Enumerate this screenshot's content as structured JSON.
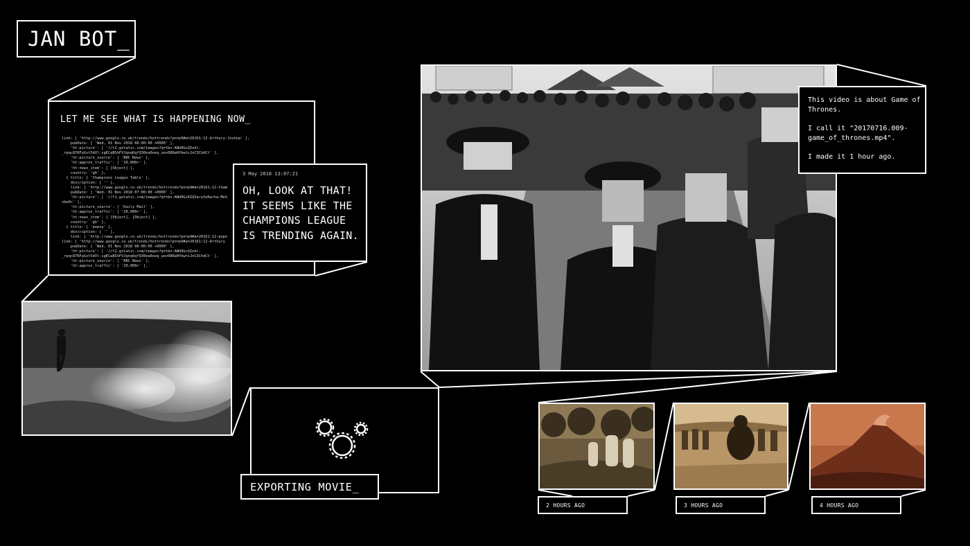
{
  "app": {
    "title": "JAN BOT_"
  },
  "log": {
    "heading": "LET ME SEE WHAT IS HAPPENING NOW_",
    "lines": [
      "link: [ 'http://www.google.co.uk/trends/hottrends?pn=p9#a=20161:12-Arthury-Joshua' ],",
      "    pubDate: [ 'Wed, 01 Nov 2018 08:00:00 +0000' ],",
      "    'ht:picture': [ '//t2.gstatic.com/images?q=tbn:ANd9GcQIekl-",
      "_rpqc87KFaSxt5dVl:sgECaBShFVJqnq6qfQ30ea0oeq_uev08RaHfbwtsJnC3ChdCt' ],",
      "    'ht:picture_source': [ 'BBC News' ],",
      "    'ht:approx_traffic': [ '20,000+' ],",
      "    'ht:news_item': [ [Object] ],",
      "    country: 'gb' },",
      "  { title: [ 'Champions League Table' ],",
      "    description: [ '' ],",
      "    link: [ 'http://www.google.co.uk/trends/hottrends?pn=p9#a=20161:12-Cham",
      "    pubDate: [ 'Wed, 01 Nov 2018 07:00:00 +0000' ],",
      "    'ht:picture': [ '//t1.gstatic.com/images?q=tbn:ANd9GcKIQVaryVoKarha:MoS",
      "vbeDc' ],",
      "    'ht:picture_source': [ 'Daily Mail' ],",
      "    'ht:approx_traffic': [ '20,000+' ],",
      "    'ht:news_item': [ [Object], [Object] ],",
      "    country: 'gb' },",
      "  { title: [ 'pepoy' ],",
      "    description: [ '' ],",
      "    link: [ 'http://www.google.co.uk/trends/hottrends?pn=p9#a=20161:12-pepo",
      "link: [ 'http://www.google.co.uk/trends/hottrends?pn=p9#a=20161:12-Arthury",
      "    pubDate: [ 'Wed, 01 Nov 2018 08:00:00 +0000' ],",
      "    'ht:picture': [ '//t2.gstatic.com/images?q=tbn:ANd9GcQIekl-",
      "_rpqc87KFaSxt5dVl:sgECaBShFVJqnq6qfQ30ea0oeq_uev08RaHfbwtsJnC3ChdCt' ],",
      "    'ht:picture_source': [ 'BBC News' ],",
      "    'ht:approx_traffic': [ '20,000+' ],"
    ]
  },
  "speech": {
    "date": "3 May 2018  13:07:21",
    "text": "OH, LOOK AT THAT! IT SEEMS LIKE THE CHAMPIONS LEAGUE IS TRENDING AGAIN."
  },
  "export": {
    "label": "EXPORTING MOVIE_"
  },
  "info": {
    "line1": "This video is about Game of Thrones.",
    "line2": "I call it \"20170716.009-game_of_thrones.mp4\".",
    "line3": "I made it 1 hour ago."
  },
  "history": [
    {
      "time": "2 HOURS AGO"
    },
    {
      "time": "3 HOURS AGO"
    },
    {
      "time": "4 HOURS AGO"
    }
  ],
  "colors": {
    "background": "#000000",
    "stroke": "#ffffff",
    "sepia": "#a0703d"
  }
}
